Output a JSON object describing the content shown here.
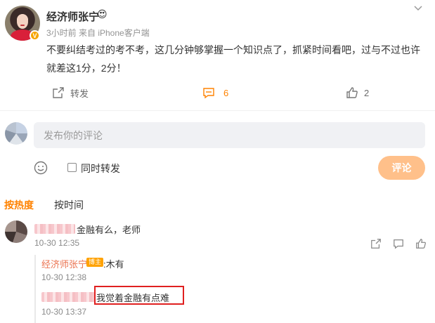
{
  "post": {
    "author": "经济师张宁",
    "author_emoji": "😍",
    "meta": "3小时前 来自 iPhone客户端",
    "text": "不要纠结考过的考不考，这几分钟够掌握一个知识点了，抓紧时间看吧，过与不过也许就差这1分，2分！",
    "actions": {
      "repost_label": "转发",
      "comment_count": "6",
      "like_count": "2"
    }
  },
  "composer": {
    "placeholder": "发布你的评论",
    "repost_label": "同时转发",
    "submit_label": "评论"
  },
  "sort_tabs": {
    "hot": "按热度",
    "time": "按时间"
  },
  "comments": [
    {
      "text": "金融有么，老师",
      "time": "10-30 12:35",
      "replies": [
        {
          "name": "经济师张宁",
          "badge": "博主",
          "text": ":木有",
          "time": "10-30 12:38"
        },
        {
          "text": "我觉着金融有点难",
          "time": "10-30 13:37"
        }
      ]
    }
  ],
  "colors": {
    "accent": "#ff8200",
    "link_name": "#eb7350",
    "submit_bg": "#ffc08a",
    "highlight_box": "#e02020"
  },
  "icons": {
    "menu": "chevron-down-icon",
    "repost": "repost-icon",
    "comment": "comment-icon",
    "like": "thumbs-up-icon",
    "emoji": "smiley-icon",
    "share": "share-icon",
    "reply": "reply-icon"
  }
}
